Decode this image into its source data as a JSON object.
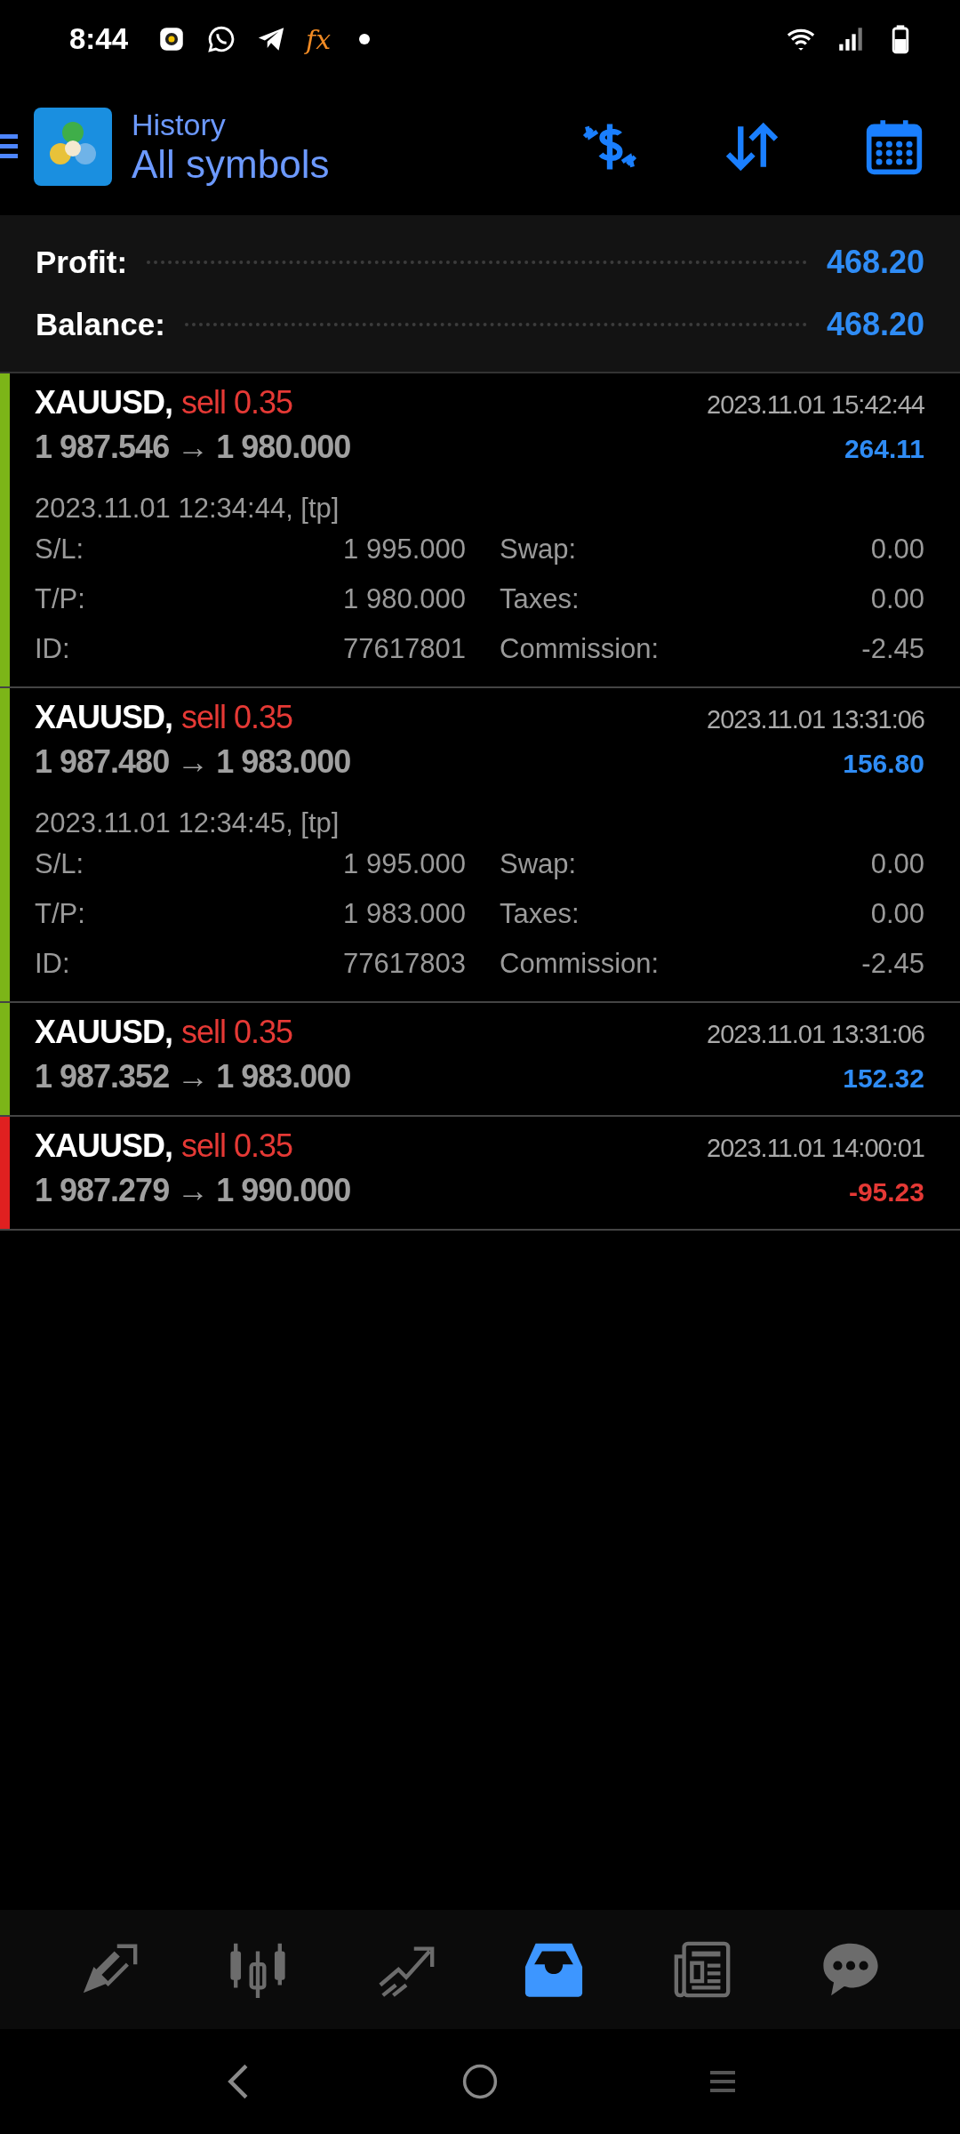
{
  "status_bar": {
    "time": "8:44",
    "app_glyph": "fx"
  },
  "header": {
    "title": "History",
    "subtitle": "All symbols"
  },
  "summary": [
    {
      "label": "Profit:",
      "value": "468.20"
    },
    {
      "label": "Balance:",
      "value": "468.20"
    }
  ],
  "trades": [
    {
      "symbol": "XAUUSD,",
      "side": "sell 0.35",
      "prices": "1 987.546 → 1 980.000",
      "close_time": "2023.11.01 15:42:44",
      "profit": "264.11",
      "loss": false,
      "expanded": true,
      "open_info": "2023.11.01 12:34:44, [tp]",
      "details": [
        {
          "label": "S/L:",
          "value": "1 995.000",
          "label2": "Swap:",
          "value2": "0.00"
        },
        {
          "label": "T/P:",
          "value": "1 980.000",
          "label2": "Taxes:",
          "value2": "0.00"
        },
        {
          "label": "ID:",
          "value": "77617801",
          "label2": "Commission:",
          "value2": "-2.45"
        }
      ]
    },
    {
      "symbol": "XAUUSD,",
      "side": "sell 0.35",
      "prices": "1 987.480 → 1 983.000",
      "close_time": "2023.11.01 13:31:06",
      "profit": "156.80",
      "loss": false,
      "expanded": true,
      "open_info": "2023.11.01 12:34:45, [tp]",
      "details": [
        {
          "label": "S/L:",
          "value": "1 995.000",
          "label2": "Swap:",
          "value2": "0.00"
        },
        {
          "label": "T/P:",
          "value": "1 983.000",
          "label2": "Taxes:",
          "value2": "0.00"
        },
        {
          "label": "ID:",
          "value": "77617803",
          "label2": "Commission:",
          "value2": "-2.45"
        }
      ]
    },
    {
      "symbol": "XAUUSD,",
      "side": "sell 0.35",
      "prices": "1 987.352 → 1 983.000",
      "close_time": "2023.11.01 13:31:06",
      "profit": "152.32",
      "loss": false,
      "expanded": false
    },
    {
      "symbol": "XAUUSD,",
      "side": "sell 0.35",
      "prices": "1 987.279 → 1 990.000",
      "close_time": "2023.11.01 14:00:01",
      "profit": "-95.23",
      "loss": true,
      "expanded": false
    }
  ],
  "bottom_nav": [
    {
      "kind": "quotes",
      "selected": false
    },
    {
      "kind": "chart",
      "selected": false
    },
    {
      "kind": "trade",
      "selected": false
    },
    {
      "kind": "history",
      "selected": true
    },
    {
      "kind": "news",
      "selected": false
    },
    {
      "kind": "chat",
      "selected": false
    }
  ]
}
